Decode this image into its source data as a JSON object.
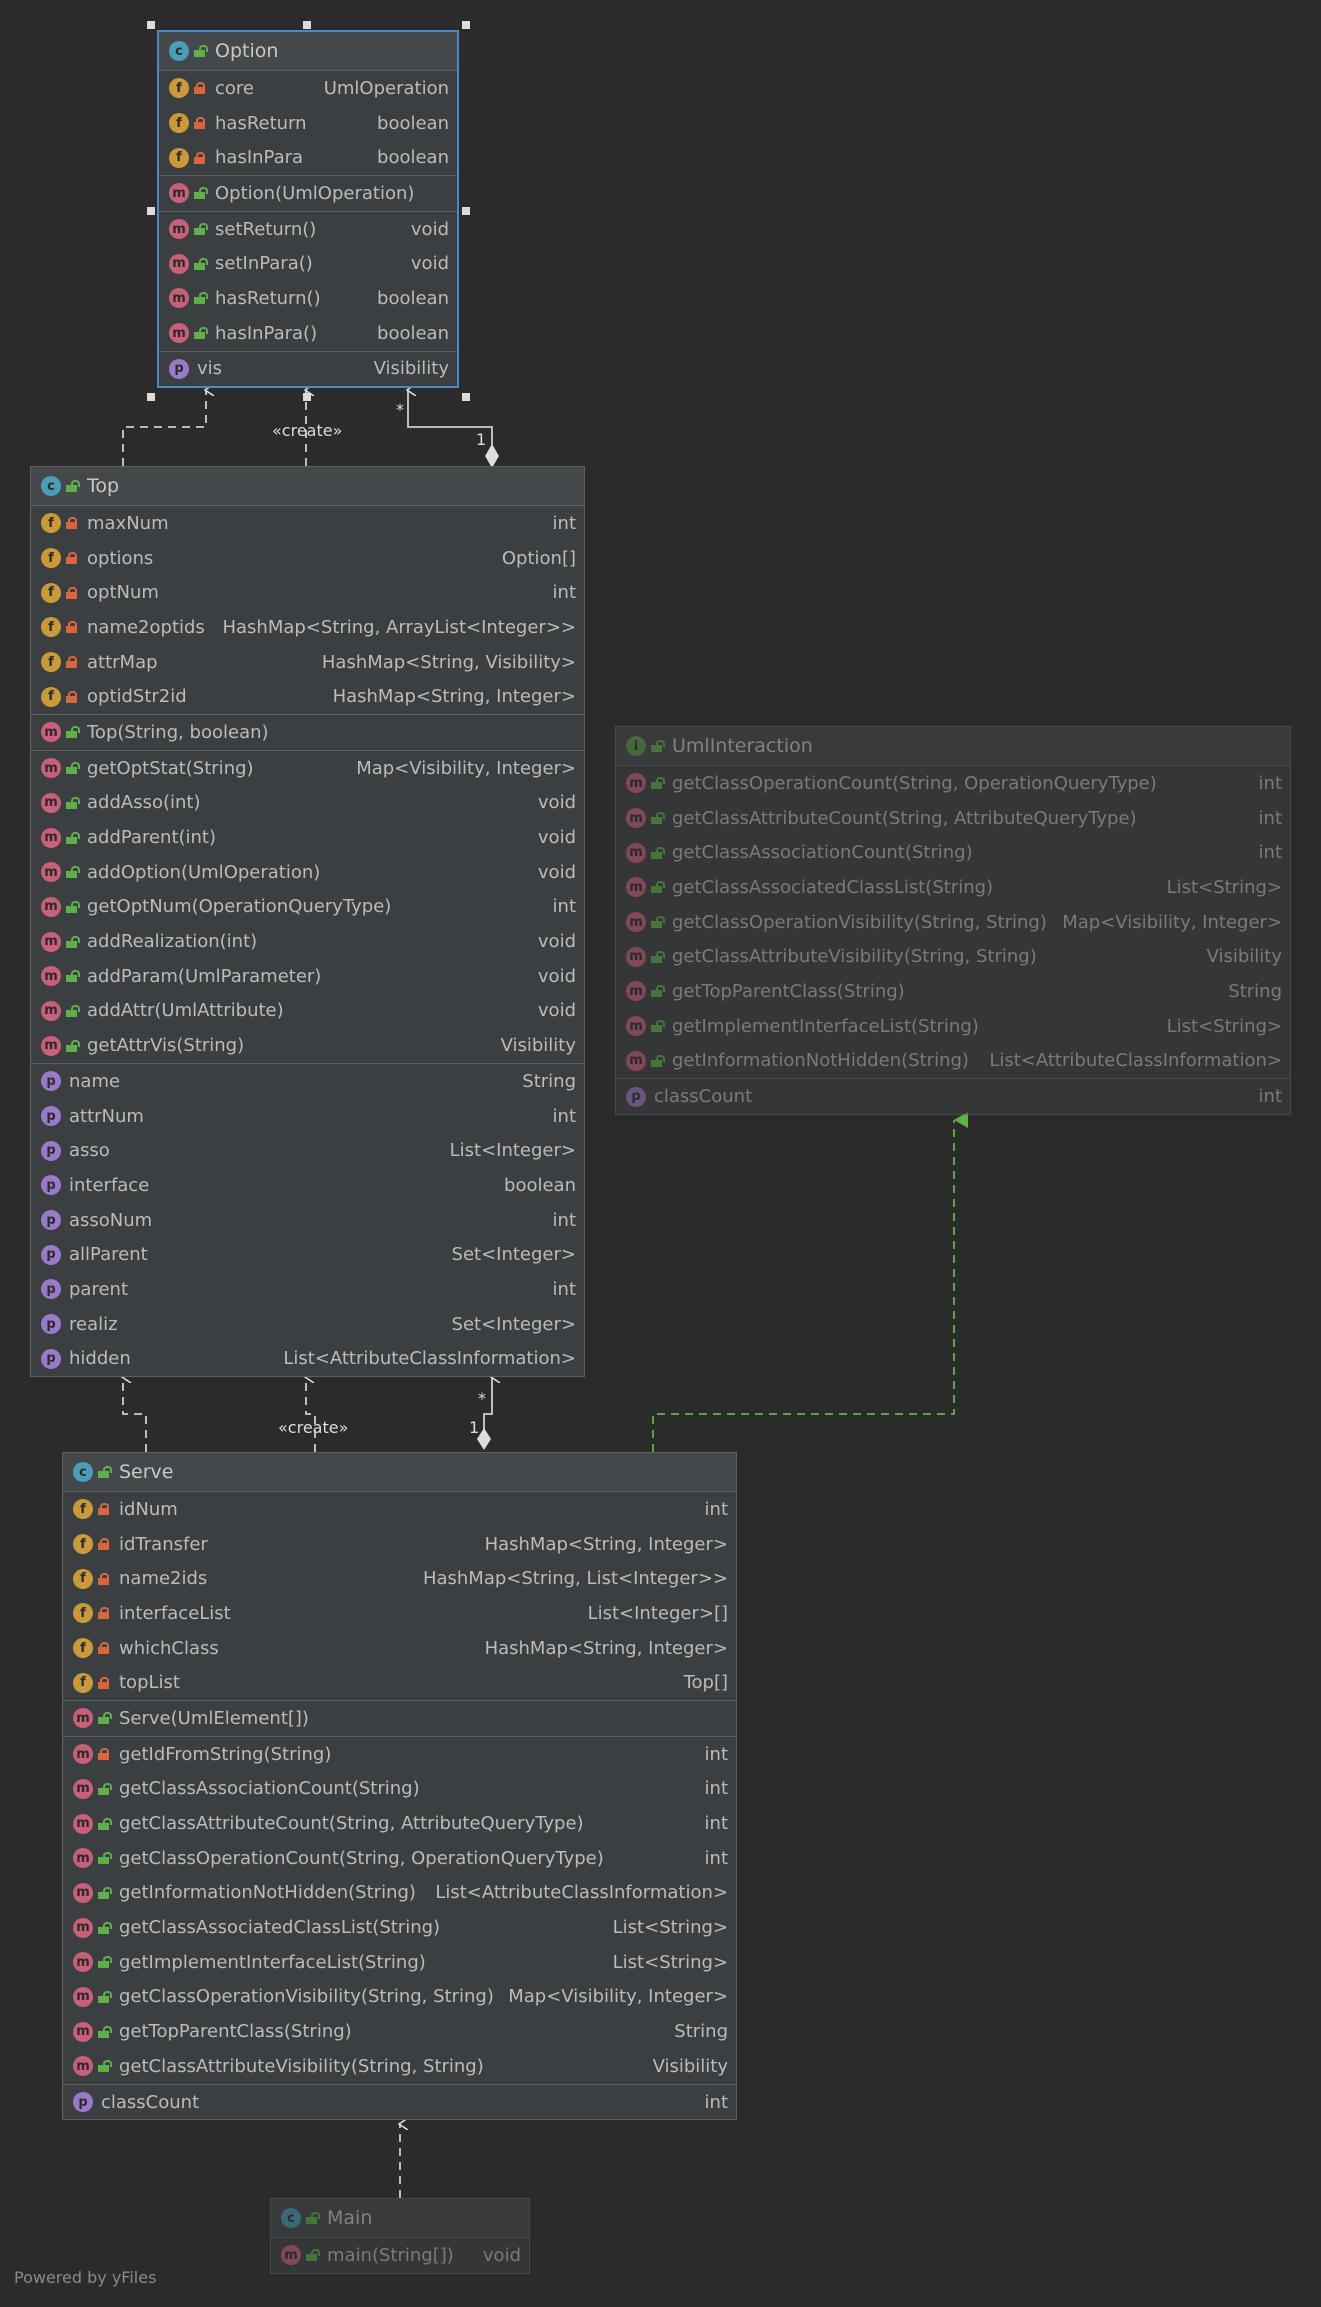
{
  "footer": "Powered by yFiles",
  "labels": {
    "create": "«create»",
    "one": "1",
    "many": "*"
  },
  "option": {
    "name": "Option",
    "fields": [
      {
        "name": "core",
        "type": "UmlOperation"
      },
      {
        "name": "hasReturn",
        "type": "boolean"
      },
      {
        "name": "hasInPara",
        "type": "boolean"
      }
    ],
    "constructors": [
      {
        "name": "Option(UmlOperation)",
        "type": ""
      }
    ],
    "methods": [
      {
        "name": "setReturn()",
        "type": "void"
      },
      {
        "name": "setInPara()",
        "type": "void"
      },
      {
        "name": "hasReturn()",
        "type": "boolean"
      },
      {
        "name": "hasInPara()",
        "type": "boolean"
      }
    ],
    "properties": [
      {
        "name": "vis",
        "type": "Visibility"
      }
    ]
  },
  "top": {
    "name": "Top",
    "fields": [
      {
        "name": "maxNum",
        "type": "int"
      },
      {
        "name": "options",
        "type": "Option[]"
      },
      {
        "name": "optNum",
        "type": "int"
      },
      {
        "name": "name2optids",
        "type": "HashMap<String, ArrayList<Integer>>"
      },
      {
        "name": "attrMap",
        "type": "HashMap<String, Visibility>"
      },
      {
        "name": "optidStr2id",
        "type": "HashMap<String, Integer>"
      }
    ],
    "constructors": [
      {
        "name": "Top(String, boolean)",
        "type": ""
      }
    ],
    "methods": [
      {
        "name": "getOptStat(String)",
        "type": "Map<Visibility, Integer>"
      },
      {
        "name": "addAsso(int)",
        "type": "void"
      },
      {
        "name": "addParent(int)",
        "type": "void"
      },
      {
        "name": "addOption(UmlOperation)",
        "type": "void"
      },
      {
        "name": "getOptNum(OperationQueryType)",
        "type": "int"
      },
      {
        "name": "addRealization(int)",
        "type": "void"
      },
      {
        "name": "addParam(UmlParameter)",
        "type": "void"
      },
      {
        "name": "addAttr(UmlAttribute)",
        "type": "void"
      },
      {
        "name": "getAttrVis(String)",
        "type": "Visibility"
      }
    ],
    "properties": [
      {
        "name": "name",
        "type": "String"
      },
      {
        "name": "attrNum",
        "type": "int"
      },
      {
        "name": "asso",
        "type": "List<Integer>"
      },
      {
        "name": "interface",
        "type": "boolean"
      },
      {
        "name": "assoNum",
        "type": "int"
      },
      {
        "name": "allParent",
        "type": "Set<Integer>"
      },
      {
        "name": "parent",
        "type": "int"
      },
      {
        "name": "realiz",
        "type": "Set<Integer>"
      },
      {
        "name": "hidden",
        "type": "List<AttributeClassInformation>"
      }
    ]
  },
  "uml": {
    "name": "UmlInteraction",
    "methods": [
      {
        "name": "getClassOperationCount(String, OperationQueryType)",
        "type": "int"
      },
      {
        "name": "getClassAttributeCount(String, AttributeQueryType)",
        "type": "int"
      },
      {
        "name": "getClassAssociationCount(String)",
        "type": "int"
      },
      {
        "name": "getClassAssociatedClassList(String)",
        "type": "List<String>"
      },
      {
        "name": "getClassOperationVisibility(String, String)",
        "type": "Map<Visibility, Integer>"
      },
      {
        "name": "getClassAttributeVisibility(String, String)",
        "type": "Visibility"
      },
      {
        "name": "getTopParentClass(String)",
        "type": "String"
      },
      {
        "name": "getImplementInterfaceList(String)",
        "type": "List<String>"
      },
      {
        "name": "getInformationNotHidden(String)",
        "type": "List<AttributeClassInformation>"
      }
    ],
    "properties": [
      {
        "name": "classCount",
        "type": "int"
      }
    ]
  },
  "serve": {
    "name": "Serve",
    "fields": [
      {
        "name": "idNum",
        "type": "int"
      },
      {
        "name": "idTransfer",
        "type": "HashMap<String, Integer>"
      },
      {
        "name": "name2ids",
        "type": "HashMap<String, List<Integer>>"
      },
      {
        "name": "interfaceList",
        "type": "List<Integer>[]"
      },
      {
        "name": "whichClass",
        "type": "HashMap<String, Integer>"
      },
      {
        "name": "topList",
        "type": "Top[]"
      }
    ],
    "constructors": [
      {
        "name": "Serve(UmlElement[])",
        "type": ""
      }
    ],
    "methods": [
      {
        "name": "getIdFromString(String)",
        "type": "int"
      },
      {
        "name": "getClassAssociationCount(String)",
        "type": "int"
      },
      {
        "name": "getClassAttributeCount(String, AttributeQueryType)",
        "type": "int"
      },
      {
        "name": "getClassOperationCount(String, OperationQueryType)",
        "type": "int"
      },
      {
        "name": "getInformationNotHidden(String)",
        "type": "List<AttributeClassInformation>"
      },
      {
        "name": "getClassAssociatedClassList(String)",
        "type": "List<String>"
      },
      {
        "name": "getImplementInterfaceList(String)",
        "type": "List<String>"
      },
      {
        "name": "getClassOperationVisibility(String, String)",
        "type": "Map<Visibility, Integer>"
      },
      {
        "name": "getTopParentClass(String)",
        "type": "String"
      },
      {
        "name": "getClassAttributeVisibility(String, String)",
        "type": "Visibility"
      }
    ],
    "properties": [
      {
        "name": "classCount",
        "type": "int"
      }
    ]
  },
  "main": {
    "name": "Main",
    "methods": [
      {
        "name": "main(String[])",
        "type": "void"
      }
    ]
  }
}
